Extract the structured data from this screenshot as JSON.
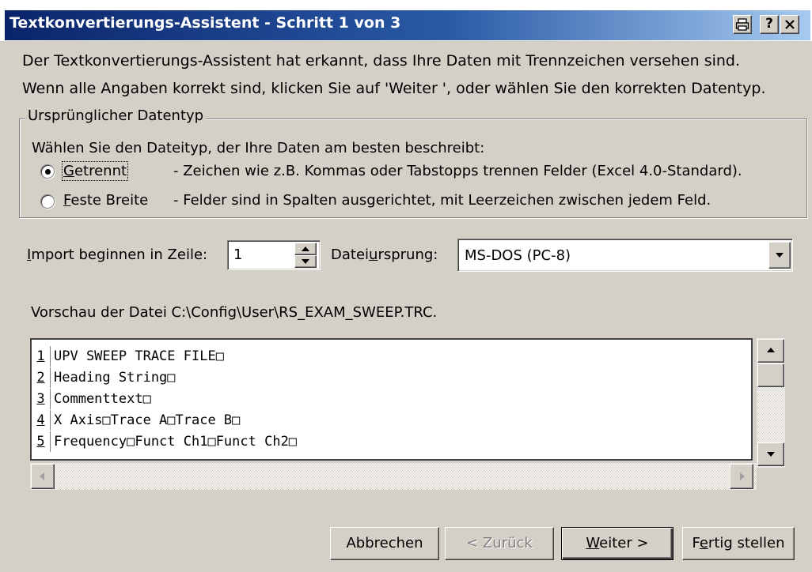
{
  "window": {
    "title": "Textkonvertierungs-Assistent - Schritt 1 von 3",
    "caption_buttons": [
      {
        "name": "print-icon",
        "label": "🖨"
      },
      {
        "name": "help",
        "label": "?"
      },
      {
        "name": "close",
        "label": "×"
      }
    ]
  },
  "description": {
    "line1": "Der Textkonvertierungs-Assistent hat erkannt, dass Ihre Daten mit Trennzeichen versehen sind.",
    "line2": "Wenn alle Angaben korrekt sind, klicken Sie auf 'Weiter ', oder wählen Sie den korrekten Datentyp."
  },
  "datatype_group": {
    "legend": "Ursprünglicher Datentyp",
    "prompt": "Wählen Sie den Dateityp, der Ihre Daten am besten beschreibt:",
    "options": [
      {
        "mnemonic": "G",
        "label_rest": "etrennt",
        "description": "- Zeichen wie z.B. Kommas oder Tabstopps trennen Felder (Excel 4.0-Standard).",
        "selected": true
      },
      {
        "mnemonic": "F",
        "label_rest": "este Breite",
        "description": "- Felder sind in Spalten ausgerichtet, mit Leerzeichen zwischen jedem Feld.",
        "selected": false
      }
    ]
  },
  "import_row": {
    "label_mnemonic": "I",
    "label_rest": "mport beginnen in Zeile:",
    "value": "1"
  },
  "origin": {
    "label_pre": "Datei",
    "label_mnemonic": "u",
    "label_post": "rsprung:",
    "value": "MS-DOS (PC-8)"
  },
  "preview": {
    "label": "Vorschau der Datei C:\\Config\\User\\RS_EXAM_SWEEP.TRC.",
    "lines": [
      {
        "num": "1",
        "text": "UPV SWEEP TRACE FILE□"
      },
      {
        "num": "2",
        "text": "Heading String□"
      },
      {
        "num": "3",
        "text": "Commenttext□"
      },
      {
        "num": "4",
        "text": "X Axis□Trace A□Trace B□"
      },
      {
        "num": "5",
        "text": "Frequency□Funct Ch1□Funct Ch2□"
      }
    ]
  },
  "buttons": {
    "cancel": "Abbrechen",
    "back": "< Zurück",
    "next_mnemonic": "W",
    "next_rest": "eiter >",
    "finish_pre": "F",
    "finish_mnemonic": "e",
    "finish_post": "rtig stellen"
  },
  "colors": {
    "dialog_bg": "#d4d0c8",
    "title_gradient_start": "#0a246a",
    "title_gradient_end": "#a6caf0"
  }
}
